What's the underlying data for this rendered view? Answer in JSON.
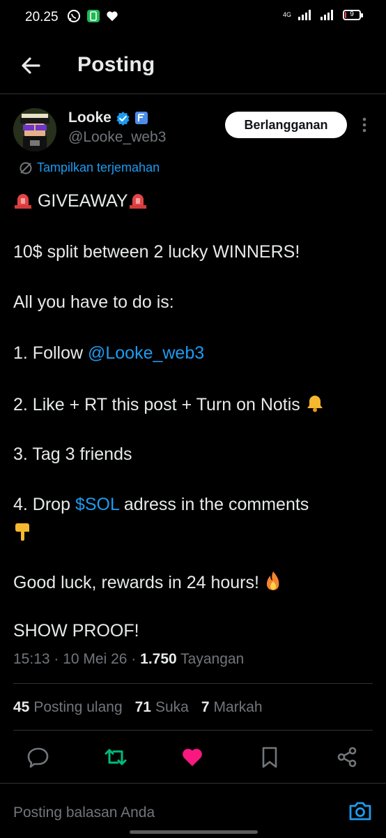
{
  "status_bar": {
    "time": "20.25",
    "network": "4G",
    "battery": "9",
    "battery_level": 0.09
  },
  "header": {
    "title": "Posting"
  },
  "author": {
    "name": "Looke",
    "handle": "@Looke_web3"
  },
  "subscribe_label": "Berlangganan",
  "translate_label": "Tampilkan terjemahan",
  "post": {
    "line1": "GIVEAWAY",
    "line2": "10$ split between 2 lucky WINNERS!",
    "line3": "All you have to do is:",
    "line4_prefix": "1. Follow ",
    "line4_link": "@Looke_web3",
    "line5": "2. Like + RT this post + Turn on Notis",
    "line6": "3. Tag 3 friends",
    "line7_prefix": "4. Drop ",
    "line7_link": "$SOL",
    "line7_suffix": " adress in the comments",
    "line8": "Good luck, rewards in 24 hours!",
    "line9": "SHOW PROOF!"
  },
  "meta": {
    "time": "15:13",
    "sep1": " · ",
    "date": "10 Mei 26",
    "sep2": " · ",
    "views": "1.750",
    "views_label": " Tayangan"
  },
  "stats": {
    "reposts": "45",
    "reposts_label": "Posting ulang",
    "likes": "71",
    "likes_label": "Suka",
    "bookmarks": "7",
    "bookmarks_label": "Markah"
  },
  "reply": {
    "placeholder": "Posting balasan Anda"
  },
  "colors": {
    "accent": "#1d9bf0",
    "retweet": "#00ba7c",
    "like": "#f91880",
    "background": "#000000",
    "text": "#e7e9ea",
    "muted": "#71767b"
  },
  "icons": [
    "back-arrow-icon",
    "verified-badge-icon",
    "affiliate-badge-icon",
    "more-vertical-icon",
    "translate-icon",
    "reply-icon",
    "retweet-icon",
    "like-icon",
    "bookmark-icon",
    "share-icon",
    "camera-icon"
  ]
}
